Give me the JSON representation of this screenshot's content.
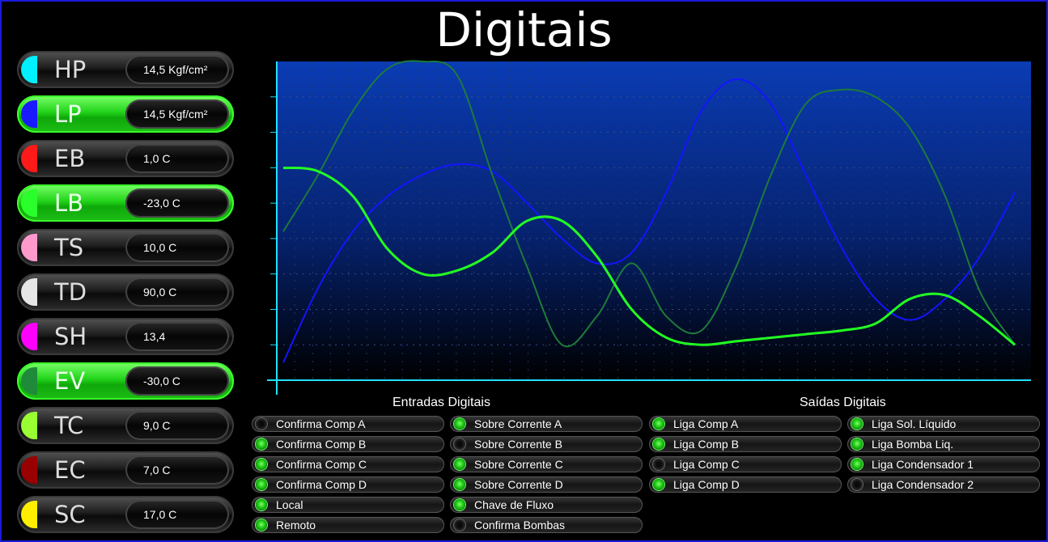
{
  "title": "Digitais",
  "sensors": [
    {
      "name": "HP",
      "value": "14,5 Kgf/cm²",
      "color": "#00f0ff",
      "active": false
    },
    {
      "name": "LP",
      "value": "14,5 Kgf/cm²",
      "color": "#1a1aff",
      "active": true
    },
    {
      "name": "EB",
      "value": "1,0 C",
      "color": "#ff1a1a",
      "active": false
    },
    {
      "name": "LB",
      "value": "-23,0 C",
      "color": "#2bff2b",
      "active": true
    },
    {
      "name": "TS",
      "value": "10,0 C",
      "color": "#ff99cc",
      "active": false
    },
    {
      "name": "TD",
      "value": "90,0 C",
      "color": "#e6e6e6",
      "active": false
    },
    {
      "name": "SH",
      "value": "13,4",
      "color": "#ff00ff",
      "active": false
    },
    {
      "name": "EV",
      "value": "-30,0 C",
      "color": "#1f8a3a",
      "active": true
    },
    {
      "name": "TC",
      "value": "9,0 C",
      "color": "#99ff33",
      "active": false
    },
    {
      "name": "EC",
      "value": "7,0 C",
      "color": "#990000",
      "active": false
    },
    {
      "name": "SC",
      "value": "17,0 C",
      "color": "#ffee00",
      "active": false
    }
  ],
  "chart_data": {
    "type": "line",
    "title": "",
    "grid": true,
    "x": [
      0,
      1,
      2,
      3,
      4,
      5,
      6,
      7,
      8,
      9,
      10,
      11,
      12,
      13,
      14,
      15,
      16,
      17,
      18,
      19,
      20,
      21
    ],
    "ylim": [
      0,
      9
    ],
    "series": [
      {
        "color": "#1414ff",
        "values": [
          0.5,
          2.6,
          4.2,
          5.2,
          5.8,
          6.1,
          5.9,
          5.0,
          4.0,
          3.3,
          3.6,
          5.3,
          7.6,
          8.5,
          7.8,
          5.8,
          3.8,
          2.3,
          1.7,
          2.3,
          3.5,
          5.3
        ]
      },
      {
        "color": "#1e7a3a",
        "values": [
          4.2,
          5.8,
          7.6,
          8.8,
          9.0,
          8.6,
          5.8,
          3.2,
          1.0,
          1.8,
          3.3,
          1.8,
          1.4,
          3.2,
          5.8,
          7.8,
          8.2,
          8.0,
          7.1,
          5.2,
          2.5,
          1.0
        ]
      },
      {
        "color": "#22ff22",
        "values": [
          6.0,
          5.9,
          5.2,
          3.7,
          3.0,
          3.1,
          3.6,
          4.5,
          4.5,
          3.5,
          2.0,
          1.2,
          1.0,
          1.1,
          1.2,
          1.3,
          1.4,
          1.6,
          2.3,
          2.4,
          1.8,
          1.0
        ]
      }
    ],
    "colors": {
      "axis": "#22e0ff",
      "bg_top": "#0a3cb4",
      "bg_bottom": "#000000"
    }
  },
  "inputs": {
    "title": "Entradas Digitais",
    "col1": [
      {
        "label": "Confirma Comp A",
        "on": false
      },
      {
        "label": "Confirma Comp B",
        "on": true
      },
      {
        "label": "Confirma Comp C",
        "on": true
      },
      {
        "label": "Confirma Comp D",
        "on": true
      },
      {
        "label": "Local",
        "on": true
      },
      {
        "label": "Remoto",
        "on": true
      }
    ],
    "col2": [
      {
        "label": "Sobre Corrente A",
        "on": true
      },
      {
        "label": "Sobre Corrente B",
        "on": false
      },
      {
        "label": "Sobre Corrente C",
        "on": true
      },
      {
        "label": "Sobre Corrente D",
        "on": true
      },
      {
        "label": "Chave de Fluxo",
        "on": true
      },
      {
        "label": "Confirma Bombas",
        "on": false
      }
    ]
  },
  "outputs": {
    "title": "Saídas Digitais",
    "col1": [
      {
        "label": "Liga Comp A",
        "on": true
      },
      {
        "label": "Liga Comp B",
        "on": true
      },
      {
        "label": "Liga Comp C",
        "on": false
      },
      {
        "label": "Liga Comp D",
        "on": true
      }
    ],
    "col2": [
      {
        "label": "Liga Sol. Líquido",
        "on": true
      },
      {
        "label": "Liga Bomba Liq.",
        "on": true
      },
      {
        "label": "Liga Condensador 1",
        "on": true
      },
      {
        "label": "Liga Condensador 2",
        "on": false
      }
    ]
  }
}
